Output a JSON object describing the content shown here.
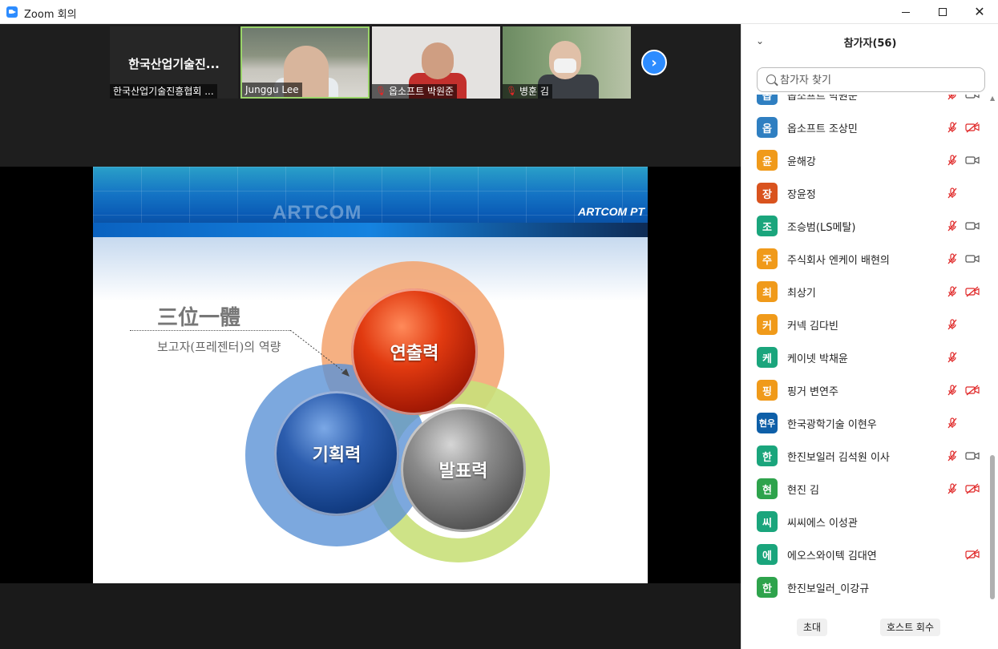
{
  "window": {
    "title": "Zoom 회의",
    "min_label": "—",
    "max_label": "☐",
    "close_label": "✕"
  },
  "video_strip": {
    "tiles": [
      {
        "big_name": "한국산업기술진...",
        "name": "한국산업기술진흥협회 ...",
        "muted": false
      },
      {
        "name": "Junggu Lee",
        "muted": false
      },
      {
        "name": "옵소프트 박원준",
        "muted": true
      },
      {
        "name": "병훈 김",
        "muted": true
      }
    ],
    "next_label": "›"
  },
  "slide": {
    "logo": "ARTCOM",
    "logo_right": "ARTCOM PT",
    "heading": "三位一體",
    "subheading": "보고자(프레젠터)의 역량",
    "sphere_top": "연출력",
    "sphere_left": "기획력",
    "sphere_right": "발표력"
  },
  "panel": {
    "collapse_icon": "chevron-down-icon",
    "title": "참가자(56)",
    "search_placeholder": "참가자 찾기",
    "participants": [
      {
        "initial": "옵",
        "name": "옵소프트 박원준",
        "color": "#2f7fc1",
        "mic": "muted",
        "cam": "on"
      },
      {
        "initial": "옵",
        "name": "옵소프트 조상민",
        "color": "#2f7fc1",
        "mic": "muted",
        "cam": "off"
      },
      {
        "initial": "윤",
        "name": "윤해강",
        "color": "#f09a1a",
        "mic": "muted",
        "cam": "on"
      },
      {
        "initial": "장",
        "name": "장윤정",
        "color": "#d9531e",
        "mic": "muted",
        "cam": "none"
      },
      {
        "initial": "조",
        "name": "조승범(LS메탈)",
        "color": "#1aa57c",
        "mic": "muted",
        "cam": "on"
      },
      {
        "initial": "주",
        "name": "주식회사 엔케이 배현의",
        "color": "#f09a1a",
        "mic": "muted",
        "cam": "on"
      },
      {
        "initial": "최",
        "name": "최상기",
        "color": "#f09a1a",
        "mic": "muted",
        "cam": "off"
      },
      {
        "initial": "커",
        "name": "커넥 김다빈",
        "color": "#f09a1a",
        "mic": "muted",
        "cam": "none"
      },
      {
        "initial": "케",
        "name": "케이넷 박채윤",
        "color": "#1aa57c",
        "mic": "muted",
        "cam": "none"
      },
      {
        "initial": "핑",
        "name": "핑거 변연주",
        "color": "#f09a1a",
        "mic": "muted",
        "cam": "off"
      },
      {
        "initial": "현우",
        "name": "한국광학기술 이현우",
        "color": "#0e5fa8",
        "mic": "muted",
        "cam": "none"
      },
      {
        "initial": "한",
        "name": "한진보일러 김석원 이사",
        "color": "#1aa57c",
        "mic": "muted",
        "cam": "on"
      },
      {
        "initial": "현",
        "name": "현진 김",
        "color": "#2ea34c",
        "mic": "muted",
        "cam": "off"
      },
      {
        "initial": "씨",
        "name": "씨씨에스 이성관",
        "color": "#1aa57c",
        "mic": "none",
        "cam": "none"
      },
      {
        "initial": "에",
        "name": "에오스와이텍 김대연",
        "color": "#1aa57c",
        "mic": "none",
        "cam": "off"
      },
      {
        "initial": "한",
        "name": "한진보일러_이강규",
        "color": "#2ea34c",
        "mic": "none",
        "cam": "none"
      }
    ],
    "invite_label": "초대",
    "reclaim_host_label": "호스트 회수"
  },
  "colors": {
    "accent": "#2d8cff",
    "muted_red": "#e02828",
    "active_speaker": "#9ad46a"
  }
}
